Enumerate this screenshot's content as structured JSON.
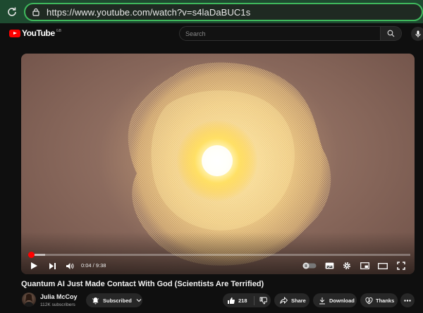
{
  "browser": {
    "url": "https://www.youtube.com/watch?v=s4laDaBUC1s"
  },
  "header": {
    "logo_text": "YouTube",
    "region": "GB",
    "search_placeholder": "Search"
  },
  "player": {
    "current_time": "0:04",
    "duration": "9:38",
    "time_display": "0:04 / 9:38",
    "progress_fraction": 0.007,
    "buffered_fraction": 0.045,
    "autoplay": "off"
  },
  "video": {
    "title": "Quantum AI Just Made Contact With God (Scientists Are Terrified)"
  },
  "channel": {
    "name": "Julia McCoy",
    "subscribers": "112K subscribers",
    "subscribe_label": "Subscribed"
  },
  "actions": {
    "likes": "218",
    "share": "Share",
    "download": "Download",
    "thanks": "Thanks"
  },
  "colors": {
    "accent": "#ff0000",
    "address_bar": "#1e4a30",
    "address_outline": "#3fb95d"
  }
}
